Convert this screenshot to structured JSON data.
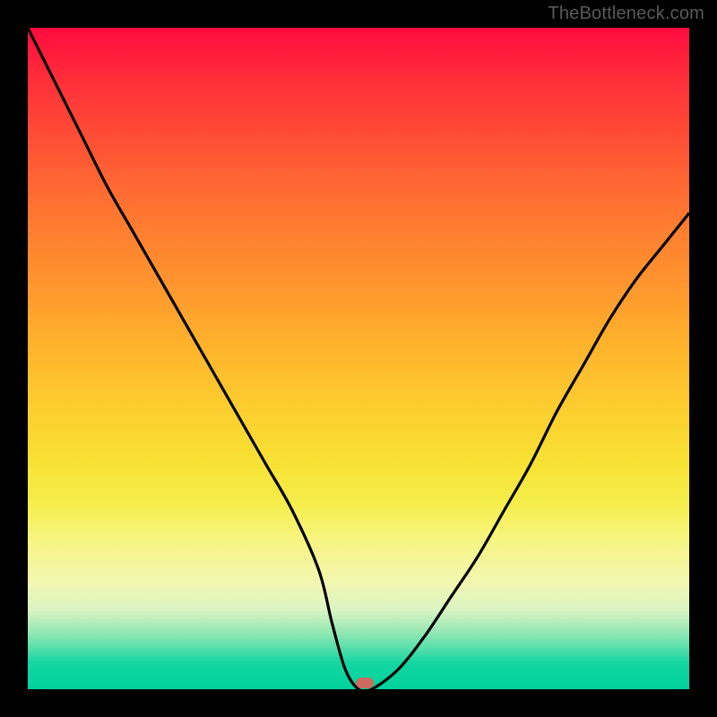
{
  "watermark": "TheBottleneck.com",
  "colors": {
    "page_bg": "#000000",
    "gradient_top": "#ff0b3e",
    "gradient_bottom": "#00d29c",
    "curve": "#000000",
    "marker": "#cc6a5f",
    "watermark_text": "#5a5a5a"
  },
  "chart_data": {
    "type": "line",
    "title": "",
    "xlabel": "",
    "ylabel": "",
    "xlim": [
      0,
      100
    ],
    "ylim": [
      0,
      100
    ],
    "series": [
      {
        "name": "bottleneck-curve",
        "x": [
          0,
          4,
          8,
          12,
          16,
          20,
          24,
          28,
          32,
          36,
          40,
          44,
          46,
          48,
          50,
          52,
          56,
          60,
          64,
          68,
          72,
          76,
          80,
          84,
          88,
          92,
          96,
          100
        ],
        "y": [
          100,
          92,
          84,
          76,
          69,
          62,
          55,
          48,
          41,
          34,
          27,
          18,
          10,
          3,
          0,
          0,
          3,
          8,
          14,
          20,
          27,
          34,
          42,
          49,
          56,
          62,
          67,
          72
        ]
      }
    ],
    "marker": {
      "x": 51,
      "y": 1
    },
    "grid": false,
    "legend": false
  }
}
